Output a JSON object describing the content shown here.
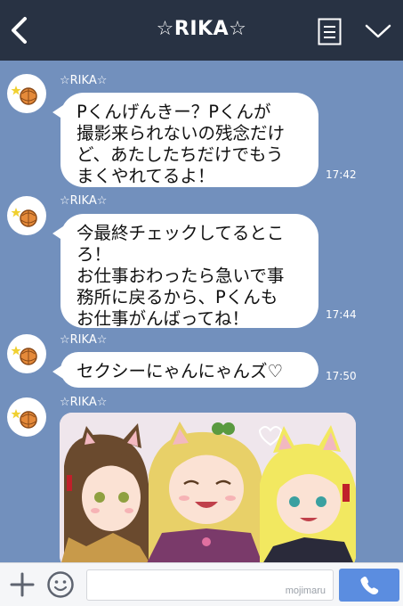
{
  "header": {
    "title": "☆RIKA☆"
  },
  "messages": [
    {
      "sender": "☆RIKA☆",
      "text": "Pくんげんきー？Pくんが\n撮影来られないの残念だけ\nど、あたしたちだけでもう\nまくやれてるよ！",
      "time": "17:42"
    },
    {
      "sender": "☆RIKA☆",
      "text": "今最終チェックしてるとこ\nろ！\nお仕事おわったら急いで事\n務所に戻るから、Pくんも\nお仕事がんばってね！",
      "time": "17:44"
    },
    {
      "sender": "☆RIKA☆",
      "text": "セクシーにゃんにゃんズ♡",
      "time": "17:50"
    },
    {
      "sender": "☆RIKA☆",
      "image": "photo-of-three-cat-eared-girls"
    }
  ],
  "footer": {
    "watermark": "mojimaru"
  },
  "colors": {
    "header_bg": "#283243",
    "chat_bg": "#7290bd",
    "send_button": "#5b8de0"
  },
  "icons": [
    "back-icon",
    "menu-icon",
    "chevron-down-icon",
    "plus-icon",
    "emoji-icon",
    "phone-icon",
    "avatar-icon"
  ]
}
